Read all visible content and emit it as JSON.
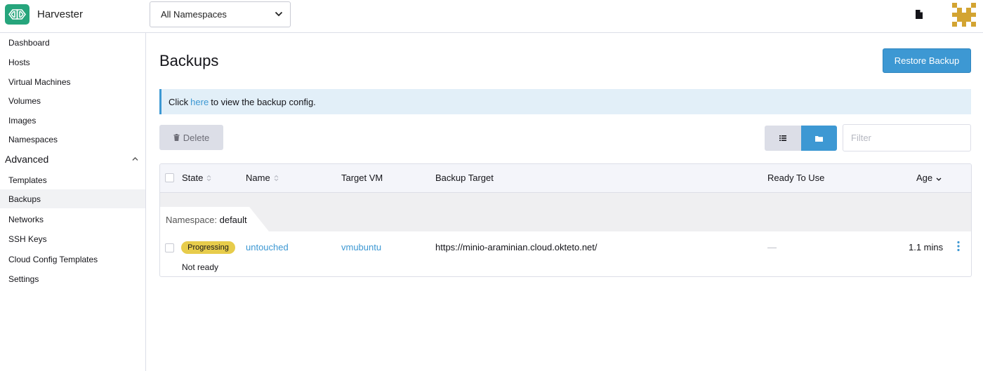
{
  "app": {
    "title": "Harvester"
  },
  "header": {
    "namespace_select": "All Namespaces"
  },
  "sidebar": {
    "items": [
      {
        "label": "Dashboard"
      },
      {
        "label": "Hosts"
      },
      {
        "label": "Virtual Machines"
      },
      {
        "label": "Volumes"
      },
      {
        "label": "Images"
      },
      {
        "label": "Namespaces"
      }
    ],
    "group": {
      "label": "Advanced"
    },
    "group_items": [
      {
        "label": "Templates"
      },
      {
        "label": "Backups",
        "active": true
      },
      {
        "label": "Networks"
      },
      {
        "label": "SSH Keys"
      },
      {
        "label": "Cloud Config Templates"
      },
      {
        "label": "Settings"
      }
    ]
  },
  "main": {
    "title": "Backups",
    "restore_button": "Restore Backup",
    "banner": {
      "prefix": "Click",
      "link": "here",
      "suffix": "to view the backup config."
    },
    "delete_button": "Delete",
    "filter_placeholder": "Filter",
    "table": {
      "headers": {
        "state": "State",
        "name": "Name",
        "target_vm": "Target VM",
        "backup_target": "Backup Target",
        "ready": "Ready To Use",
        "age": "Age"
      },
      "group": {
        "key": "Namespace:",
        "value": "default"
      },
      "rows": [
        {
          "state": "Progressing",
          "state_detail": "Not ready",
          "name": "untouched",
          "target_vm": "vmubuntu",
          "backup_target": "https://minio-araminian.cloud.okteto.net/",
          "ready": "—",
          "age": "1.1 mins"
        }
      ]
    }
  },
  "colors": {
    "accent": "#3d98d3",
    "logo_green": "#26a57c",
    "progressing_badge": "#e7cc4b",
    "banner_bg": "#e2eff8"
  },
  "icons": {
    "logo": "harvester-logo-icon",
    "namespace_chevron": "chevron-down-icon",
    "header_doc": "document-icon",
    "avatar": "avatar-icon",
    "group_chevron": "chevron-up-icon",
    "delete": "trash-icon",
    "list_view": "list-icon",
    "folder_view": "folder-icon",
    "sort": "sort-icon",
    "row_menu": "kebab-menu-icon"
  }
}
